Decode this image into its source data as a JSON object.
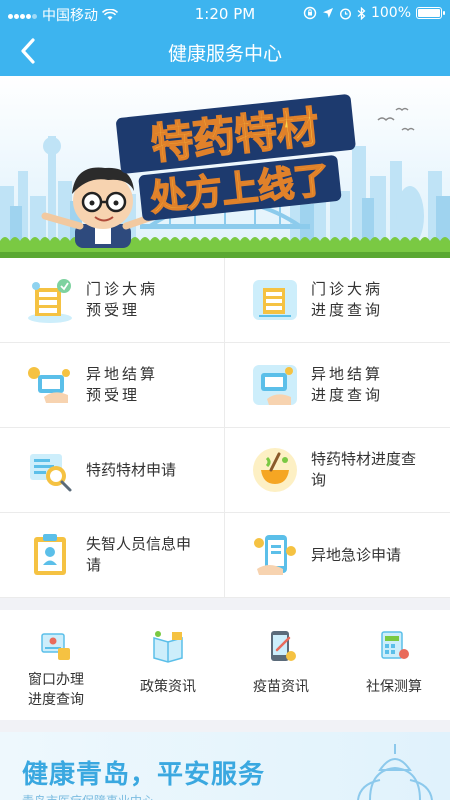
{
  "status_bar": {
    "carrier": "中国移动",
    "time": "1:20 PM",
    "battery": "100%",
    "battery_level": 1.0
  },
  "nav": {
    "title": "健康服务中心"
  },
  "banner": {
    "headline": "特药特材",
    "subline": "处方上线了"
  },
  "services": [
    {
      "line1": "门诊大病",
      "line2": "预受理",
      "icon": "hospital-building-icon"
    },
    {
      "line1": "门诊大病",
      "line2": "进度查询",
      "icon": "hospital-progress-icon"
    },
    {
      "line1": "异地结算",
      "line2": "预受理",
      "icon": "remote-settlement-icon"
    },
    {
      "line1": "异地结算",
      "line2": "进度查询",
      "icon": "settlement-progress-icon"
    },
    {
      "line1": "特药特材申请",
      "line2": "",
      "icon": "special-drug-apply-icon"
    },
    {
      "line1": "特药特材进度查",
      "line2": "询",
      "icon": "mortar-pestle-icon"
    },
    {
      "line1": "失智人员信息申",
      "line2": "请",
      "icon": "clipboard-icon"
    },
    {
      "line1": "异地急诊申请",
      "line2": "",
      "icon": "phone-emergency-icon"
    }
  ],
  "quick_links": [
    {
      "line1": "窗口办理",
      "line2": "进度查询",
      "icon": "window-service-icon"
    },
    {
      "line1": "政策资讯",
      "line2": "",
      "icon": "policy-book-icon"
    },
    {
      "line1": "疫苗资讯",
      "line2": "",
      "icon": "vaccine-phone-icon"
    },
    {
      "line1": "社保测算",
      "line2": "",
      "icon": "calculator-icon"
    }
  ],
  "slogan": {
    "title": "健康青岛，平安服务",
    "subtitle": "青岛市医疗保障事业中心"
  },
  "colors": {
    "primary": "#3db4ef",
    "accent_orange": "#f5a623",
    "grass": "#7ac943"
  }
}
